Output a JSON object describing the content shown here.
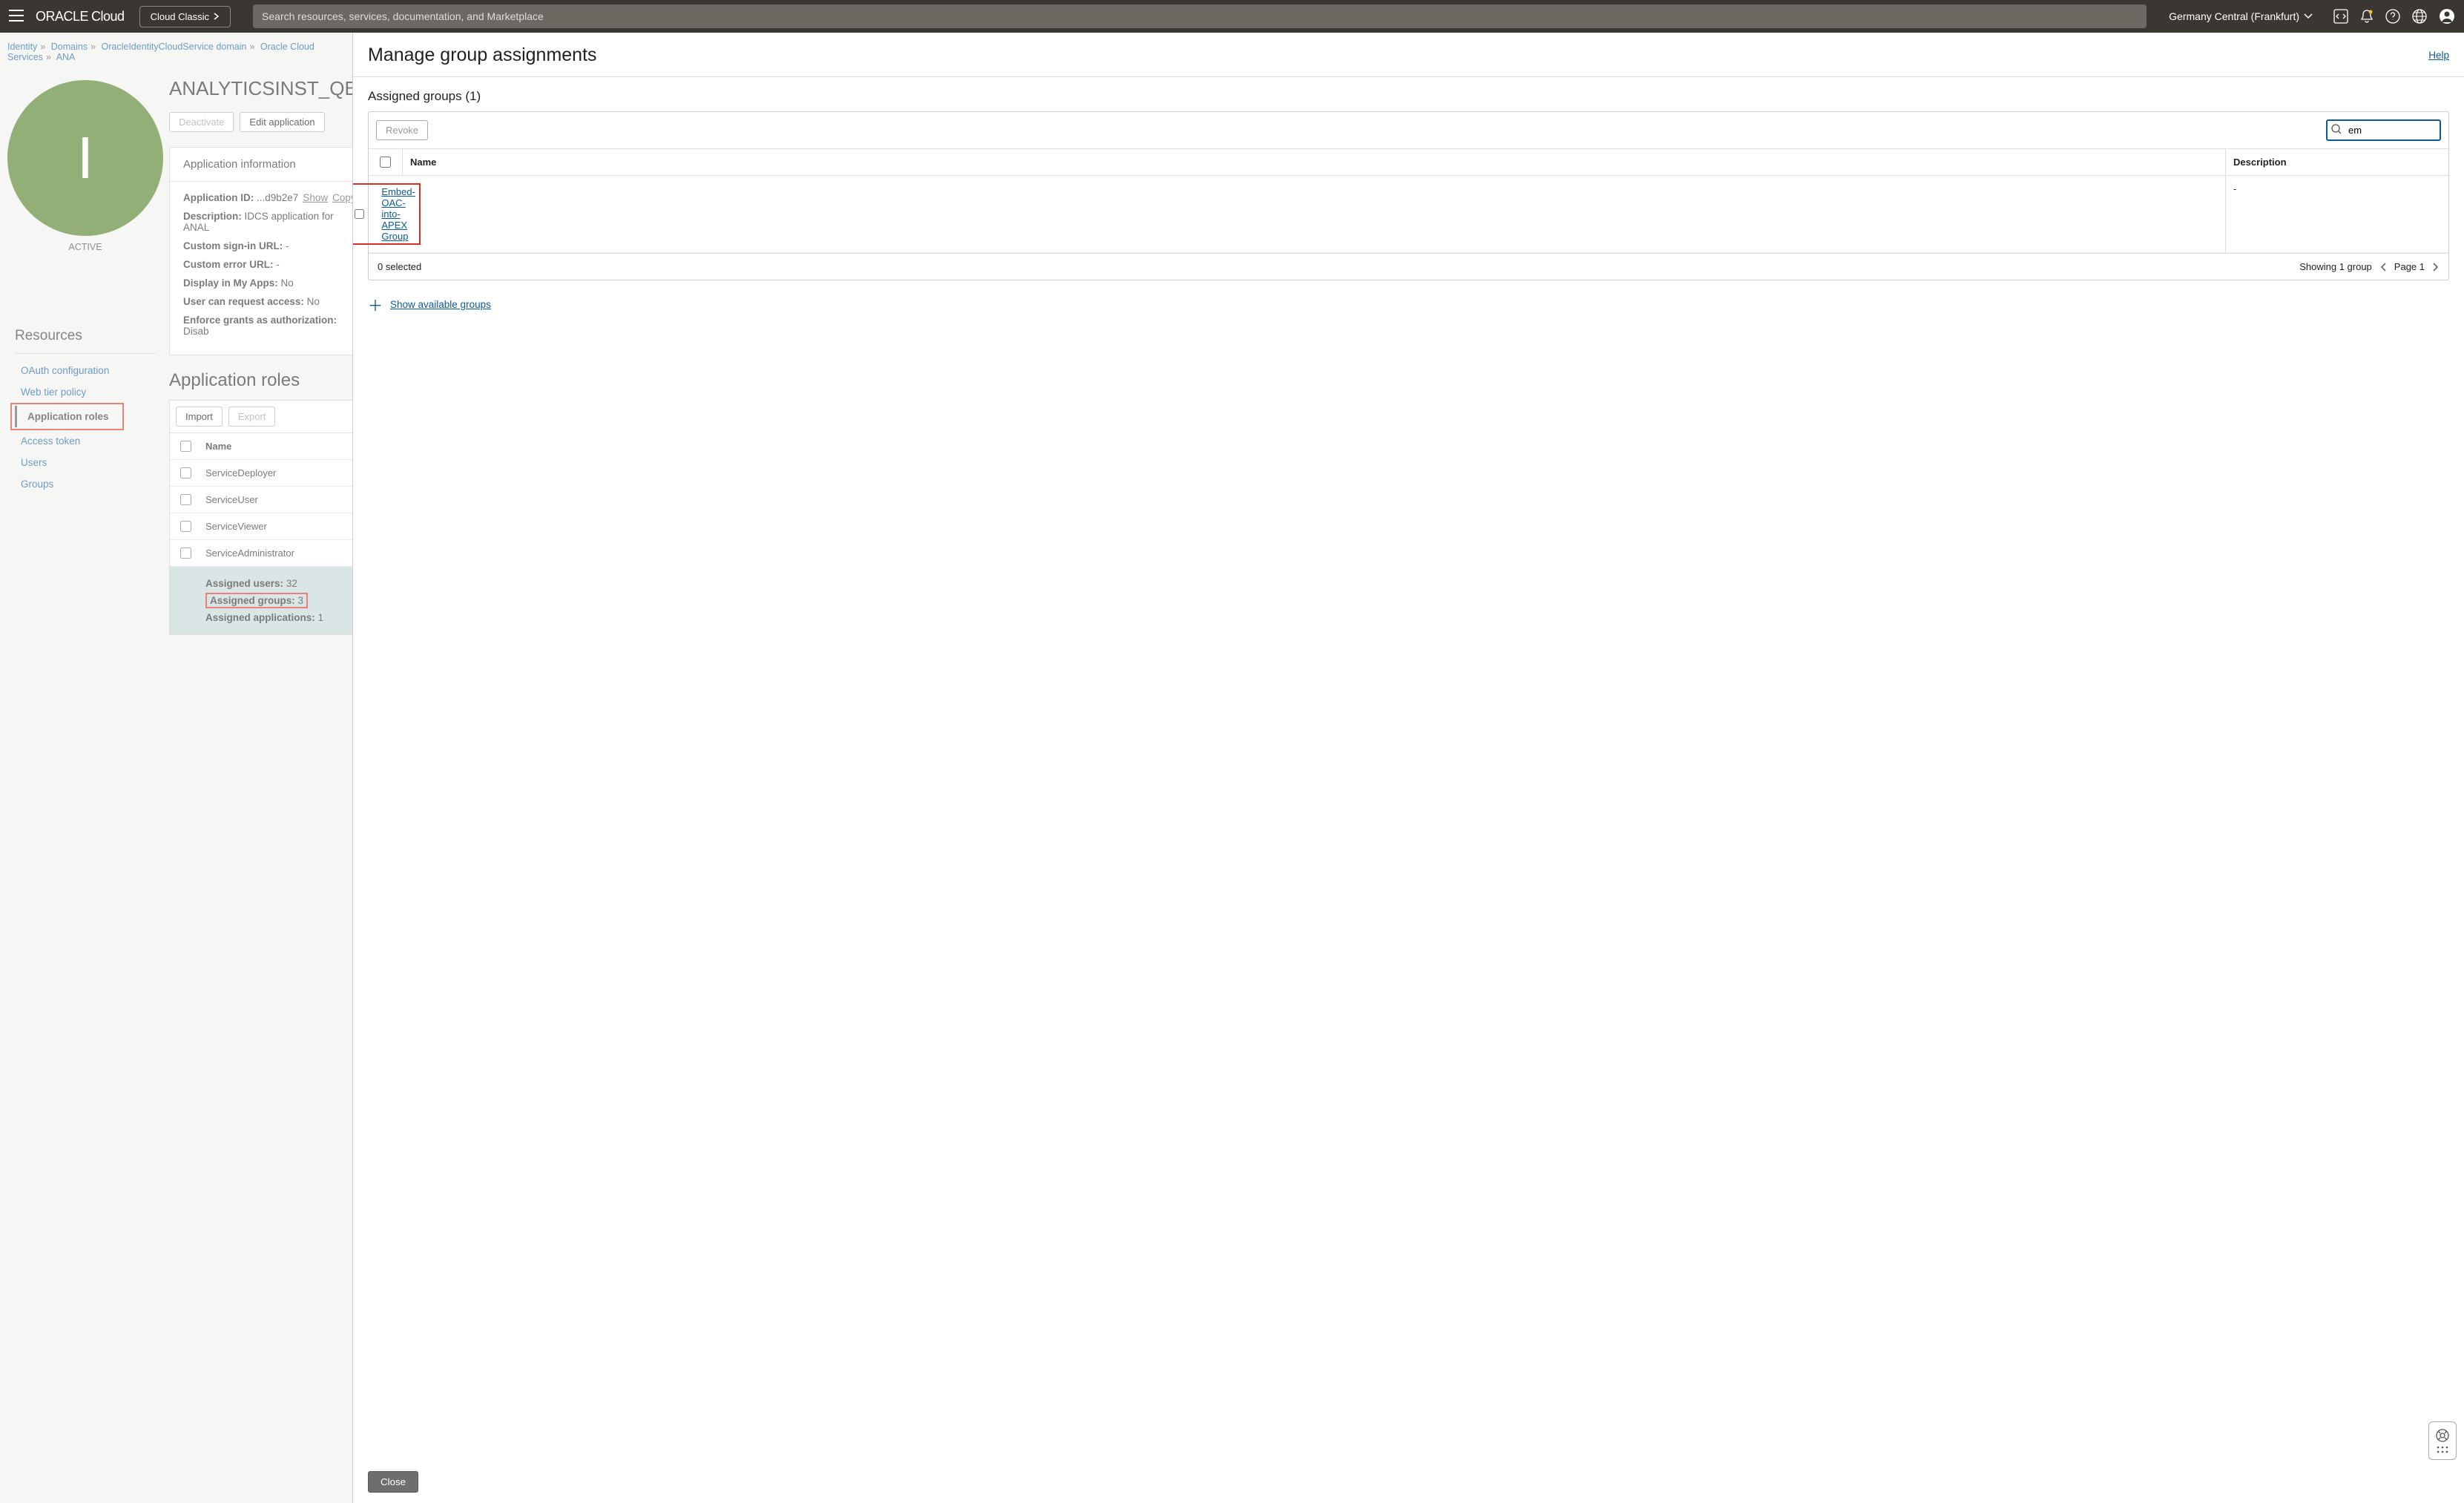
{
  "header": {
    "logo_oracle": "ORACLE",
    "logo_cloud": "Cloud",
    "cloud_classic": "Cloud Classic",
    "search_placeholder": "Search resources, services, documentation, and Marketplace",
    "region": "Germany Central (Frankfurt)"
  },
  "breadcrumb": {
    "items": [
      "Identity",
      "Domains",
      "OracleIdentityCloudService domain",
      "Oracle Cloud Services",
      "ANA"
    ]
  },
  "avatar": {
    "letter": "I",
    "status": "ACTIVE"
  },
  "app": {
    "title": "ANALYTICSINST_QBX",
    "deactivate": "Deactivate",
    "edit": "Edit application"
  },
  "app_info": {
    "heading": "Application information",
    "app_id_label": "Application ID:",
    "app_id_value": "...d9b2e7",
    "show": "Show",
    "copy": "Copy",
    "description_label": "Description:",
    "description_value": "IDCS application for ANAL",
    "custom_signin_label": "Custom sign-in URL:",
    "custom_signin_value": "-",
    "custom_error_label": "Custom error URL:",
    "custom_error_value": "-",
    "display_myapps_label": "Display in My Apps:",
    "display_myapps_value": "No",
    "request_access_label": "User can request access:",
    "request_access_value": "No",
    "enforce_grants_label": "Enforce grants as authorization:",
    "enforce_grants_value": "Disab"
  },
  "resources": {
    "title": "Resources",
    "items": [
      "OAuth configuration",
      "Web tier policy",
      "Application roles",
      "Access token",
      "Users",
      "Groups"
    ],
    "active_index": 2
  },
  "roles": {
    "title": "Application roles",
    "import": "Import",
    "export": "Export",
    "name_header": "Name",
    "rows": [
      "ServiceDeployer",
      "ServiceUser",
      "ServiceViewer",
      "ServiceAdministrator"
    ],
    "expanded": {
      "assigned_users_label": "Assigned users:",
      "assigned_users_value": "32",
      "assigned_groups_label": "Assigned groups:",
      "assigned_groups_value": "3",
      "assigned_apps_label": "Assigned applications:",
      "assigned_apps_value": "1"
    }
  },
  "drawer": {
    "title": "Manage group assignments",
    "help": "Help",
    "assigned_heading": "Assigned groups (1)",
    "revoke": "Revoke",
    "search_value": "em",
    "col_name": "Name",
    "col_description": "Description",
    "group_name": "Embed-OAC-into-APEX Group",
    "group_desc": "-",
    "selected_text": "0 selected",
    "showing_text": "Showing 1 group",
    "page_text": "Page 1",
    "show_available": "Show available groups",
    "close": "Close"
  }
}
